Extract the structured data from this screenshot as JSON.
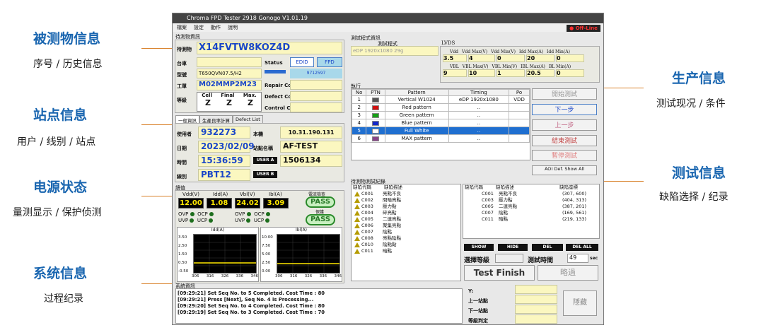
{
  "annotations": [
    {
      "title": "被测物信息",
      "sub": "序号 / 历史信息"
    },
    {
      "title": "站点信息",
      "sub": "用户 / 线别 / 站点"
    },
    {
      "title": "电源状态",
      "sub": "量测显示 / 保护侦测"
    },
    {
      "title": "系统信息",
      "sub": "过程纪录"
    },
    {
      "title": "生产信息",
      "sub": "测试现况 / 条件"
    },
    {
      "title": "测试信息",
      "sub": "缺陷选择 / 纪录"
    }
  ],
  "window": {
    "title": "Chroma FPD Tester 2918 Gonogo V1.01.19",
    "status": "Off-Line",
    "menu": [
      "檔案",
      "設定",
      "動作",
      "說明"
    ]
  },
  "dut": {
    "group": "待測物資訊",
    "sn_label": "待測物",
    "sn": "X14FVTW8KOZ4D",
    "board_label": "台車",
    "model_label": "型號",
    "model": "T650QVN07.5/H2",
    "order_label": "工單",
    "order": "M02MMP2M23",
    "grade_label": "等級",
    "grade_headers": [
      "Cell",
      "Final",
      "Max."
    ],
    "grades": [
      "Z",
      "Z",
      "Z"
    ],
    "status_label": "Status",
    "edid": "EDID",
    "fpd": "FPD",
    "fpd_code": "9712597",
    "repair_label": "Repair Code",
    "defect_label": "Defect Code",
    "control_label": "Control Code"
  },
  "tabs": [
    "一般資訊",
    "生產良率計算",
    "Defect List"
  ],
  "station": {
    "user_label": "使用者",
    "user": "932273",
    "machine_label": "本機",
    "ip": "10.31.190.131",
    "date_label": "日期",
    "date": "2023/02/09",
    "station_label": "站點名稱",
    "station": "AF-TEST",
    "time_label": "時間",
    "time": "15:36:59",
    "usera": "USER A",
    "usera_val": "1506134",
    "line_label": "線別",
    "line": "PBT12",
    "userb": "USER B"
  },
  "power": {
    "group": "讀值",
    "labels": [
      "Vdd(V)",
      "Idd(A)",
      "Vbl(V)",
      "Ibl(A)"
    ],
    "values": [
      "12.00",
      "1.08",
      "24.02",
      "3.09"
    ],
    "current_check": "電流檢查",
    "protect": "保護",
    "pass": "PASS",
    "flags": [
      [
        "OVP",
        "OCP"
      ],
      [
        "UVP",
        "UCP"
      ]
    ]
  },
  "graphs": [
    {
      "title": "Idd(A)",
      "yticks": [
        "3.50",
        "2.50",
        "1.50",
        "0.50",
        "-0.50"
      ],
      "xticks": [
        "306",
        "316",
        "326",
        "336",
        "346"
      ]
    },
    {
      "title": "Ibl(A)",
      "yticks": [
        "10.00",
        "7.50",
        "5.00",
        "2.50",
        "0.00"
      ],
      "xticks": [
        "306",
        "316",
        "326",
        "336",
        "346"
      ]
    }
  ],
  "system": {
    "group": "系統資訊",
    "logs": [
      "[09:29:21] Set Seq No. to 5 Completed. Cost Time : 80",
      "[09:29:21] Press [Next], Seq No. 4 is Processing...",
      "[09:29:20] Set Seq No. to 4 Completed. Cost Time : 80",
      "[09:29:19] Set Seq No. to 3 Completed. Cost Time : 70"
    ]
  },
  "program": {
    "group": "測試程式資訊",
    "label": "測試程式",
    "value": "eDP 1920x1080 29g",
    "lvds": "LVDS",
    "vrow1_headers": [
      "Vdd",
      "Vdd Max(V)",
      "Vdd Min(V)",
      "Idd Max(A)",
      "Idd Min(A)"
    ],
    "vrow1_values": [
      "3.5",
      "4",
      "0",
      "20",
      "0"
    ],
    "vrow2_headers": [
      "VBL",
      "VBL Max(V)",
      "VBL Min(V)",
      "IBL Max(A)",
      "BL Min(A)"
    ],
    "vrow2_values": [
      "9",
      "10",
      "1",
      "20.5",
      "0"
    ]
  },
  "exec": {
    "group": "執行",
    "headers": [
      "No",
      "PTN",
      "Pattern",
      "Timing",
      "Po"
    ],
    "rows": [
      {
        "no": "1",
        "pattern": "Vertical W1024",
        "timing": "eDP 1920x1080",
        "po": "VDD",
        "sw": "#555"
      },
      {
        "no": "2",
        "pattern": "Red pattern",
        "timing": "..",
        "po": "",
        "sw": "#d21010"
      },
      {
        "no": "3",
        "pattern": "Green pattern",
        "timing": "..",
        "po": "",
        "sw": "#16a016"
      },
      {
        "no": "4",
        "pattern": "Blue pattern",
        "timing": "..",
        "po": "",
        "sw": "#1428c8"
      },
      {
        "no": "5",
        "pattern": "Full White",
        "timing": "..",
        "po": "",
        "sw": "#ffffff"
      },
      {
        "no": "6",
        "pattern": "MAX pattern",
        "timing": "..",
        "po": "",
        "sw": "#884488"
      }
    ]
  },
  "side_buttons": [
    "開始測試",
    "下一步",
    "上一步",
    "結束測試",
    "暫停測試",
    "AOI Def. Show All"
  ],
  "defects": {
    "group": "待測物測試紀錄",
    "h1": "缺陷代碼",
    "h2": "缺陷描述",
    "list": [
      [
        "C001",
        "亮點不良"
      ],
      [
        "C002",
        "問暗亮點"
      ],
      [
        "C003",
        "壓力點"
      ],
      [
        "C004",
        "碎亮點"
      ],
      [
        "C005",
        "二連亮點"
      ],
      [
        "C006",
        "聚集亮點"
      ],
      [
        "C007",
        "陰點"
      ],
      [
        "C008",
        "亮點陰點"
      ],
      [
        "C010",
        "陰點黏"
      ],
      [
        "C011",
        "暗點"
      ]
    ],
    "r_headers": [
      "缺陷代碼",
      "缺陷描述",
      "缺陷座標"
    ],
    "recorded": [
      [
        "C001",
        "亮點不良",
        "(307, 600)"
      ],
      [
        "C003",
        "壓力點",
        "(404, 313)"
      ],
      [
        "C005",
        "二連亮點",
        "(387, 201)"
      ],
      [
        "C007",
        "陰點",
        "(169, 561)"
      ],
      [
        "C011",
        "暗點",
        "(219, 133)"
      ]
    ],
    "show": "SHOW",
    "hide": "HIDE",
    "del": "DEL",
    "delall": "DEL ALL",
    "grade_label": "選擇等級",
    "time_label": "測試時間",
    "time": "49",
    "sec": "sec",
    "finish": "Test Finish",
    "skip": "略過",
    "hide_btn": "隱藏",
    "y_label": "Y:",
    "prev": "上一站點",
    "next": "下一站點",
    "judge": "等級判定"
  }
}
